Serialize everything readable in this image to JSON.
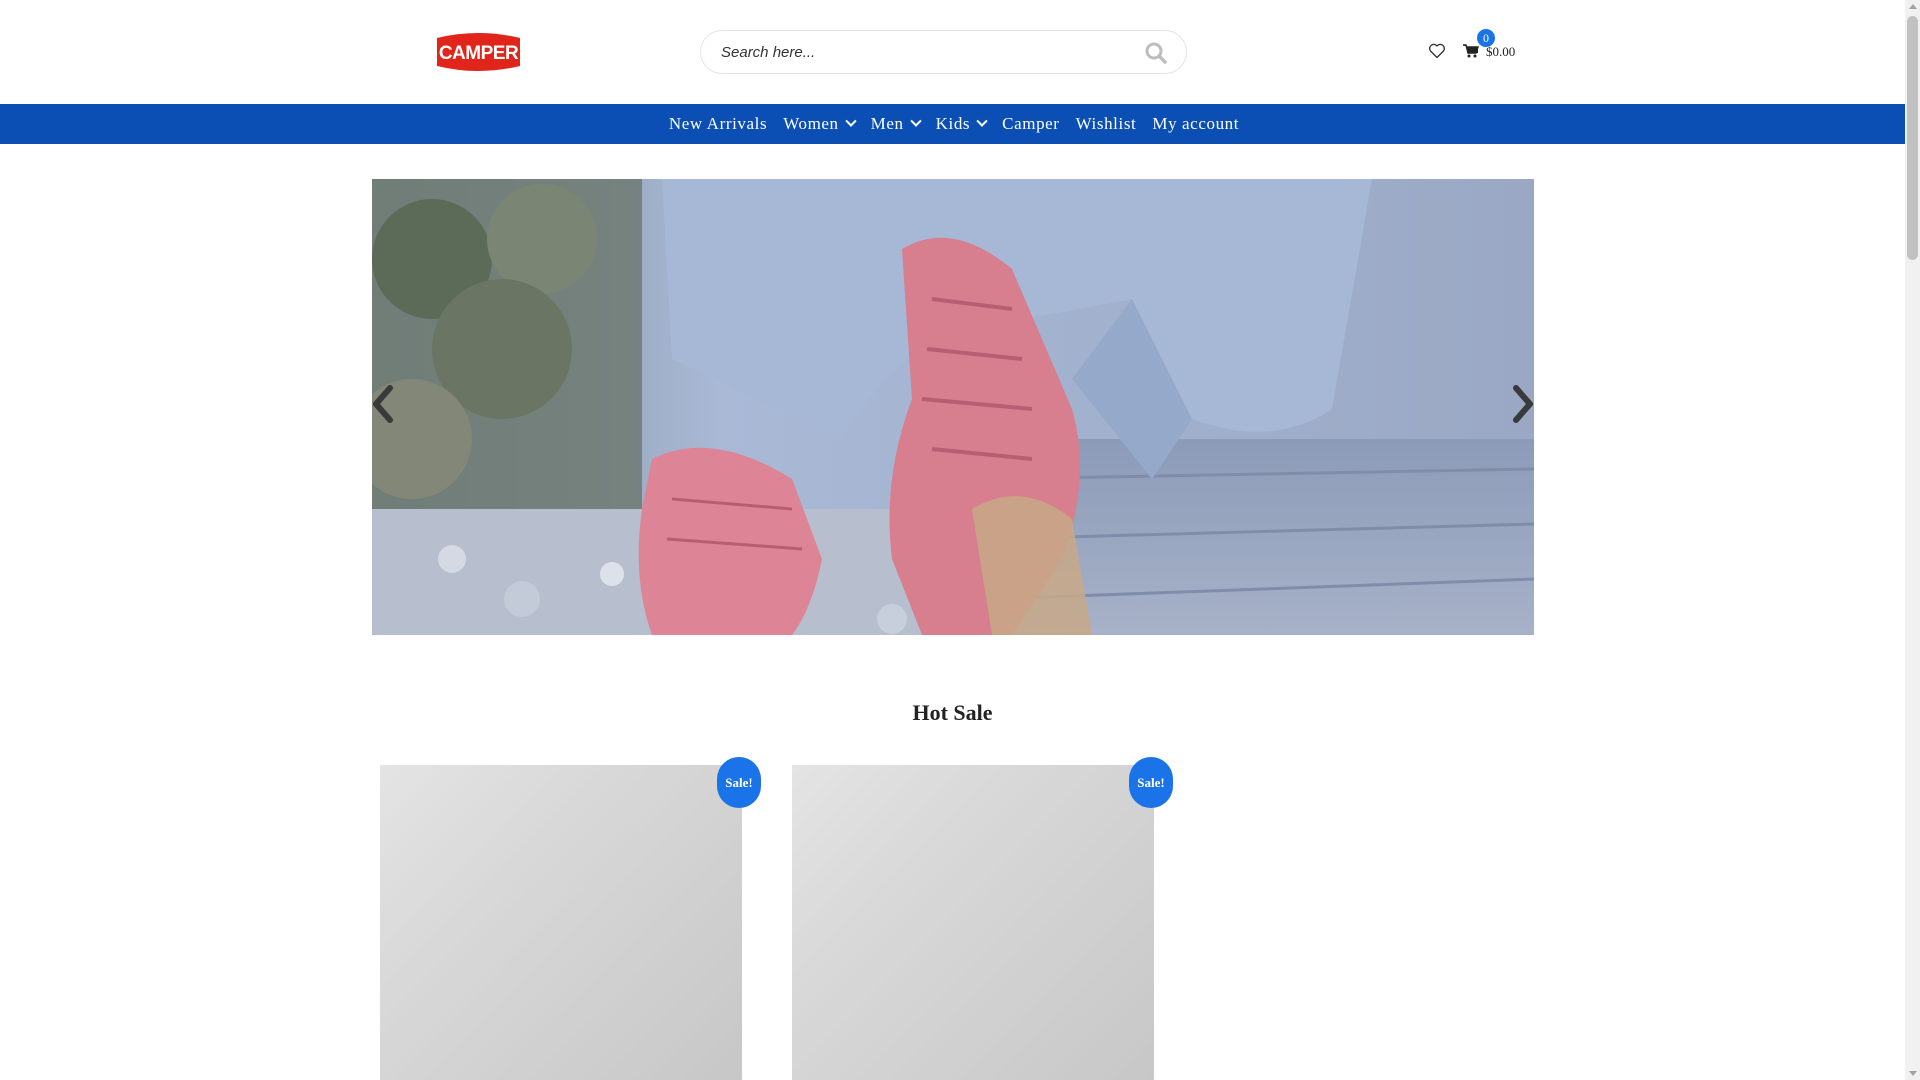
{
  "brand": {
    "logo_text": "CAMPER",
    "logo_color": "#e1251b"
  },
  "search": {
    "placeholder": "Search here..."
  },
  "header": {
    "cart_count": "0",
    "cart_total": "$0.00",
    "icons": [
      "heart-icon",
      "cart-icon",
      "search-icon"
    ]
  },
  "nav": {
    "items": [
      {
        "label": "New Arrivals",
        "has_dropdown": false
      },
      {
        "label": "Women",
        "has_dropdown": true
      },
      {
        "label": "Men",
        "has_dropdown": true
      },
      {
        "label": "Kids",
        "has_dropdown": true
      },
      {
        "label": "Camper",
        "has_dropdown": false
      },
      {
        "label": "Wishlist",
        "has_dropdown": false
      },
      {
        "label": "My account",
        "has_dropdown": false
      }
    ],
    "background": "#0b4fb5"
  },
  "slider": {
    "icons": [
      "chevron-left-icon",
      "chevron-right-icon"
    ]
  },
  "hot_sale": {
    "title": "Hot Sale",
    "badge_color": "#1a73e8",
    "products": [
      {
        "badge": "Sale!"
      },
      {
        "badge": "Sale!"
      }
    ]
  }
}
